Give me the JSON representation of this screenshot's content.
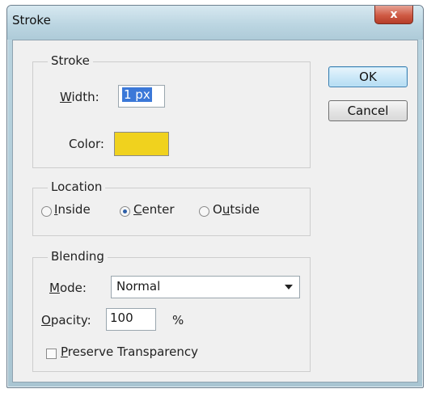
{
  "window": {
    "title": "Stroke",
    "close_glyph": "x"
  },
  "stroke_group": {
    "legend": "Stroke",
    "width_label_pre": "",
    "width_label_mnemonic": "W",
    "width_label_post": "idth:",
    "width_value": "1 px",
    "color_label": "Color:",
    "color_swatch": "#f0d21e"
  },
  "buttons": {
    "ok": "OK",
    "cancel": "Cancel"
  },
  "location_group": {
    "legend": "Location",
    "options": [
      {
        "mnemonic": "I",
        "rest": "nside",
        "checked": false
      },
      {
        "mnemonic": "C",
        "rest": "enter",
        "checked": true
      },
      {
        "pre": "O",
        "mnemonic": "u",
        "rest": "tside",
        "checked": false
      }
    ]
  },
  "blending_group": {
    "legend": "Blending",
    "mode_mnemonic": "M",
    "mode_rest": "ode:",
    "mode_value": "Normal",
    "opacity_mnemonic": "O",
    "opacity_rest": "pacity:",
    "opacity_value": "100",
    "opacity_unit": "%",
    "preserve_mnemonic": "P",
    "preserve_rest": "reserve Transparency",
    "preserve_checked": false
  }
}
